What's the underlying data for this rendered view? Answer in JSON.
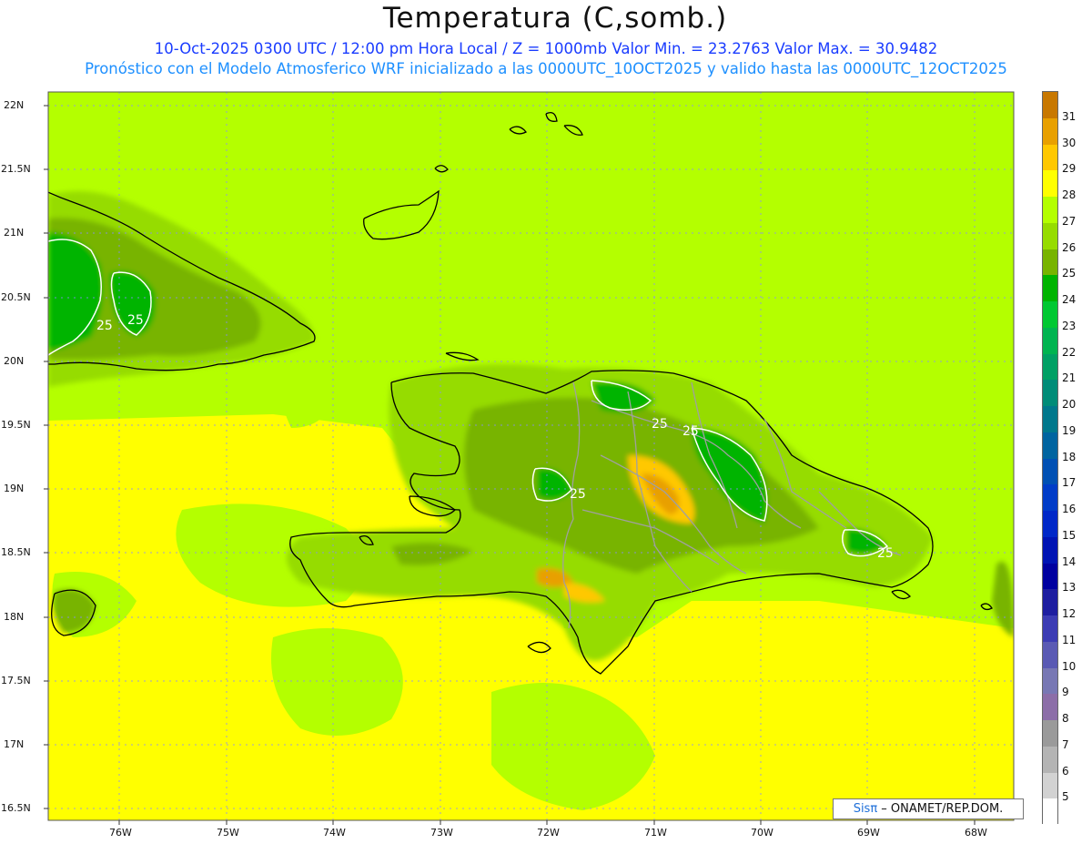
{
  "title": "Temperatura (C,somb.)",
  "subtitle_line1": "10-Oct-2025 0300 UTC / 12:00 pm Hora Local / Z = 1000mb   Valor Min. = 23.2763  Valor Max. = 30.9482",
  "subtitle_line2": "Pronóstico con el Modelo Atmosferico WRF inicializado a las 0000UTC_10OCT2025 y valido hasta las  0000UTC_12OCT2025",
  "badge": {
    "brand": "Sisπ",
    "text": " – ONAMET/REP.DOM."
  },
  "lat_labels": [
    "22N",
    "21.5N",
    "21N",
    "20.5N",
    "20N",
    "19.5N",
    "19N",
    "18.5N",
    "18N",
    "17.5N",
    "17N",
    "16.5N"
  ],
  "lon_labels": [
    "76W",
    "75W",
    "74W",
    "73W",
    "72W",
    "71W",
    "70W",
    "69W",
    "68W"
  ],
  "contour_labels": [
    "25",
    "25",
    "25",
    "25",
    "25",
    "25"
  ],
  "colorbar": {
    "labels": [
      "31",
      "30",
      "29",
      "28",
      "27",
      "26",
      "25",
      "24",
      "23",
      "22",
      "21",
      "20",
      "19",
      "18",
      "17",
      "16",
      "15",
      "14",
      "13",
      "12",
      "11",
      "10",
      "9",
      "8",
      "7",
      "6",
      "5"
    ],
    "colors": [
      "#c87800",
      "#e8a000",
      "#ffc800",
      "#ffff00",
      "#b4ff00",
      "#96dc00",
      "#78b400",
      "#00b400",
      "#00c832",
      "#00b450",
      "#00a064",
      "#008c78",
      "#00788c",
      "#0064a0",
      "#0050b4",
      "#003cc8",
      "#0028c8",
      "#0014b4",
      "#0000a0",
      "#1e1ea0",
      "#3c3cb4",
      "#5a5ab4",
      "#7878b4",
      "#8c6ea8",
      "#9a9a9a",
      "#b4b4b4",
      "#d2d2d2",
      "#ffffff"
    ]
  }
}
